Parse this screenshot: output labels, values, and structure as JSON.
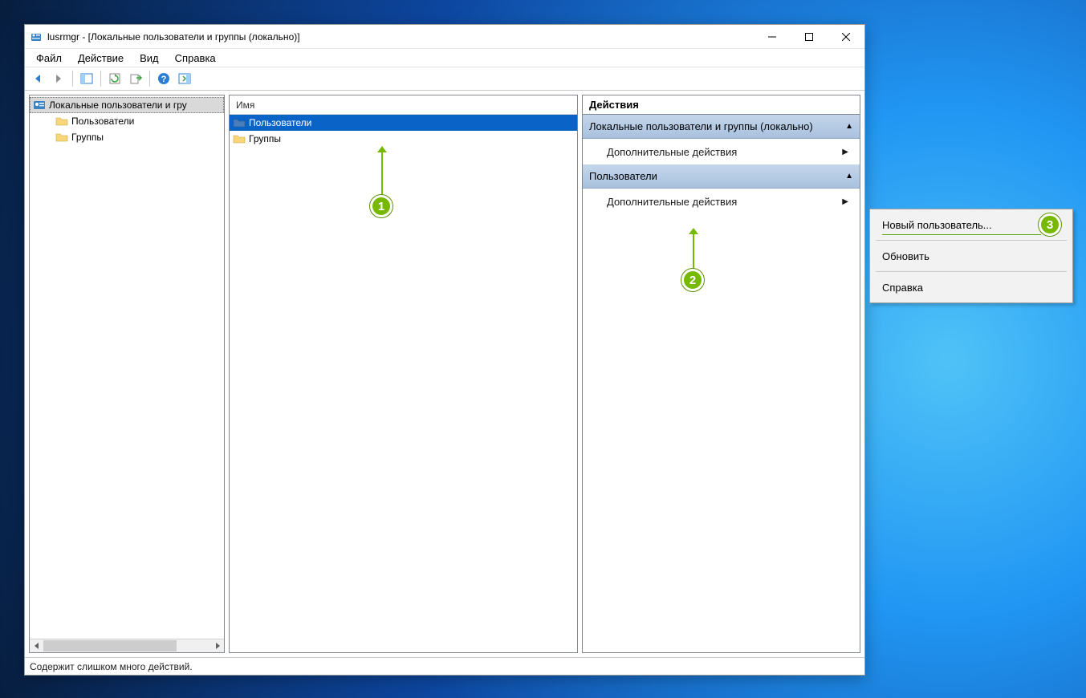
{
  "title": "lusrmgr - [Локальные пользователи и группы (локально)]",
  "menubar": {
    "file": "Файл",
    "action": "Действие",
    "view": "Вид",
    "help": "Справка"
  },
  "tree": {
    "root": "Локальные пользователи и гру",
    "users": "Пользователи",
    "groups": "Группы"
  },
  "list": {
    "header_name": "Имя",
    "items": {
      "users": "Пользователи",
      "groups": "Группы"
    }
  },
  "actions_pane": {
    "title": "Действия",
    "section1": "Локальные пользователи и группы (локально)",
    "link_more": "Дополнительные действия",
    "section2": "Пользователи"
  },
  "context_menu": {
    "new_user": "Новый пользователь...",
    "refresh": "Обновить",
    "help": "Справка"
  },
  "statusbar": "Содержит слишком много действий.",
  "badges": {
    "b1": "1",
    "b2": "2",
    "b3": "3"
  }
}
